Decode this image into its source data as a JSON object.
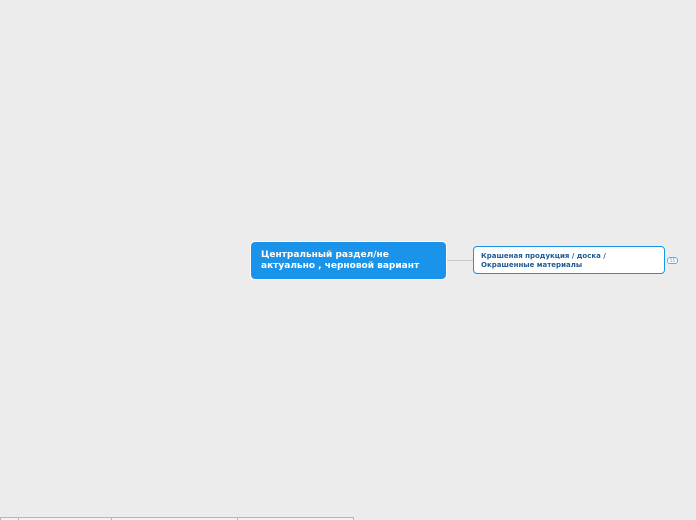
{
  "mindmap": {
    "central": {
      "line1": "Центральный раздел/не",
      "line2": "актуально , черновой вариант"
    },
    "children": [
      {
        "line1": "Крашеная продукция / доска /",
        "line2": "Окрашенные материалы",
        "collapsed_count": "55"
      }
    ]
  },
  "colors": {
    "background": "#ececec",
    "central_fill": "#1a94ea",
    "child_border": "#1a94ea",
    "child_text": "#1f5a96",
    "connector": "#c7c7c7"
  }
}
